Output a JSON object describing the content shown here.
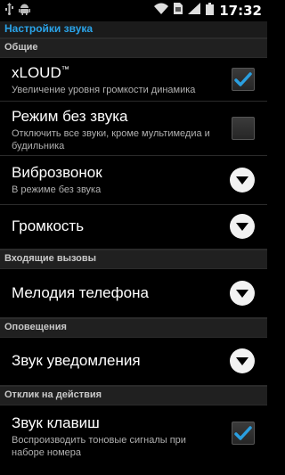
{
  "status_bar": {
    "time": "17:32",
    "icons": [
      "usb-icon",
      "android-debug-icon",
      "wifi-icon",
      "sim-icon",
      "signal-icon",
      "battery-icon"
    ]
  },
  "title_bar": {
    "title": "Настройки звука"
  },
  "sections": {
    "general": "Общие",
    "incoming_calls": "Входящие вызовы",
    "notifications": "Оповещения",
    "feedback": "Отклик на действия"
  },
  "settings": {
    "xloud": {
      "title": "xLOUD",
      "trademark": "™",
      "summary": "Увеличение уровня громкости динамика",
      "checked": true
    },
    "silent_mode": {
      "title": "Режим без звука",
      "summary": "Отключить все звуки, кроме мультимедиа и будильника",
      "checked": false
    },
    "vibrate": {
      "title": "Виброзвонок",
      "summary": "В режиме без звука"
    },
    "volume": {
      "title": "Громкость"
    },
    "ringtone": {
      "title": "Мелодия телефона"
    },
    "notification_sound": {
      "title": "Звук уведомления"
    },
    "touch_tones": {
      "title": "Звук клавиш",
      "summary": "Воспроизводить тоновые сигналы при наборе номера",
      "checked": true
    }
  },
  "colors": {
    "accent": "#2aa3e8",
    "checkmark": "#2a9fe0",
    "background": "#000000",
    "section_header": "#202020"
  }
}
